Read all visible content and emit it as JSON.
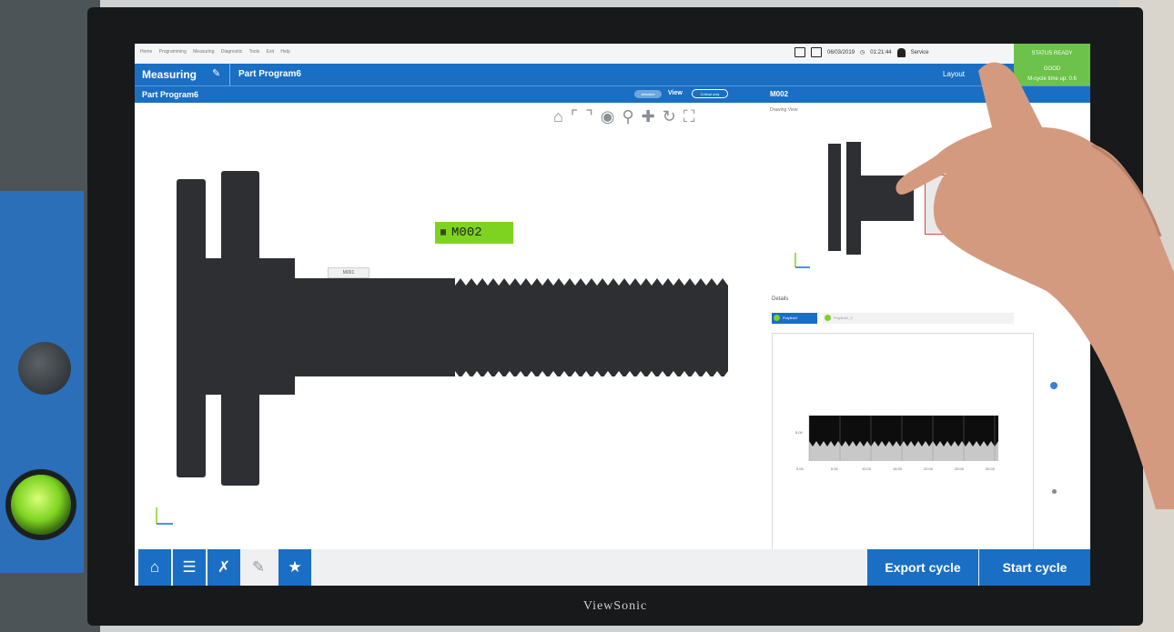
{
  "menu": {
    "items": [
      "Home",
      "Programming",
      "Measuring",
      "Diagnostic",
      "Tools",
      "Exit",
      "Help"
    ]
  },
  "status": {
    "date": "06/03/2019",
    "time": "01:21:44",
    "user": "Service",
    "ready": "STATUS READY",
    "good": "GOOD",
    "good_sub": "M-cycle time up: 0.6"
  },
  "header": {
    "section": "Measuring",
    "program": "Part Program6",
    "layout": "Layout"
  },
  "subheader": {
    "program": "Part Program6",
    "absolute": "absolute",
    "view": "View",
    "critical": "Critical only",
    "feature": "M002"
  },
  "drawing": {
    "view_label": "Drawing View",
    "tag_main": "M002",
    "tag_secondary": "M001",
    "toolbar_icons": [
      "home-icon",
      "fit-x-icon",
      "fit-y-icon",
      "target-icon",
      "zoom-icon",
      "pan-icon",
      "rotate-icon",
      "expand-icon"
    ]
  },
  "details": {
    "label": "Details",
    "tab_active": "Polyline2",
    "tab_inactive": "Polyline2_2"
  },
  "chart_data": {
    "type": "area",
    "x_ticks": [
      "0.00",
      "5.00",
      "10.00",
      "15.00",
      "20.00",
      "25.00",
      "30.00"
    ],
    "y_ticks": [
      "5.00"
    ],
    "grid": true,
    "legend": "none"
  },
  "bottom": {
    "icons": [
      "home-icon",
      "checklist-icon",
      "tools-icon",
      "pencil-icon",
      "star-icon"
    ],
    "export": "Export cycle",
    "start": "Start cycle"
  },
  "monitor": {
    "brand": "ViewSonic"
  },
  "colors": {
    "accent": "#1a6fc4",
    "status_green": "#6cc24a",
    "tag_green": "#7ed321",
    "part": "#2e2f33"
  }
}
